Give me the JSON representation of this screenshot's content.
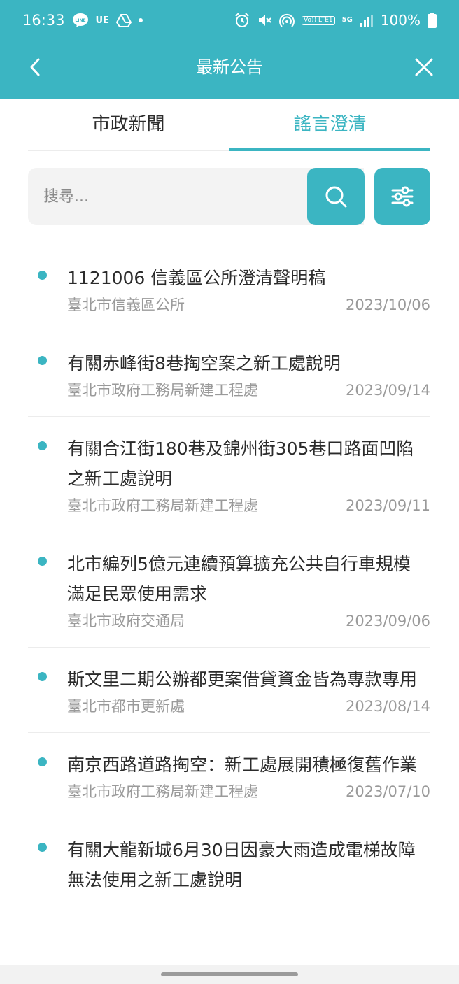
{
  "status_bar": {
    "time": "16:33",
    "notif_line": "LINE",
    "notif_ue": "UE",
    "volte": "Vo)) LTE1",
    "net_5g": "5G",
    "battery": "100%"
  },
  "header": {
    "title": "最新公告"
  },
  "tabs": [
    {
      "label": "市政新聞",
      "active": false
    },
    {
      "label": "謠言澄清",
      "active": true
    }
  ],
  "search": {
    "placeholder": "搜尋...",
    "value": ""
  },
  "items": [
    {
      "title": "1121006 信義區公所澄清聲明稿",
      "source": "臺北市信義區公所",
      "date": "2023/10/06"
    },
    {
      "title": "有關赤峰街8巷掏空案之新工處說明",
      "source": "臺北市政府工務局新建工程處",
      "date": "2023/09/14"
    },
    {
      "title": "有關合江街180巷及錦州街305巷口路面凹陷之新工處說明",
      "source": "臺北市政府工務局新建工程處",
      "date": "2023/09/11"
    },
    {
      "title": "北市編列5億元連續預算擴充公共自行車規模 滿足民眾使用需求",
      "source": "臺北市政府交通局",
      "date": "2023/09/06"
    },
    {
      "title": "斯文里二期公辦都更案借貸資金皆為專款專用",
      "source": "臺北市都市更新處",
      "date": "2023/08/14"
    },
    {
      "title": "南京西路道路掏空：新工處展開積極復舊作業",
      "source": "臺北市政府工務局新建工程處",
      "date": "2023/07/10"
    },
    {
      "title": "有關大龍新城6月30日因豪大雨造成電梯故障無法使用之新工處說明",
      "source": "",
      "date": ""
    }
  ],
  "colors": {
    "accent": "#3bb5c2",
    "meta_text": "#9a9a9a"
  }
}
